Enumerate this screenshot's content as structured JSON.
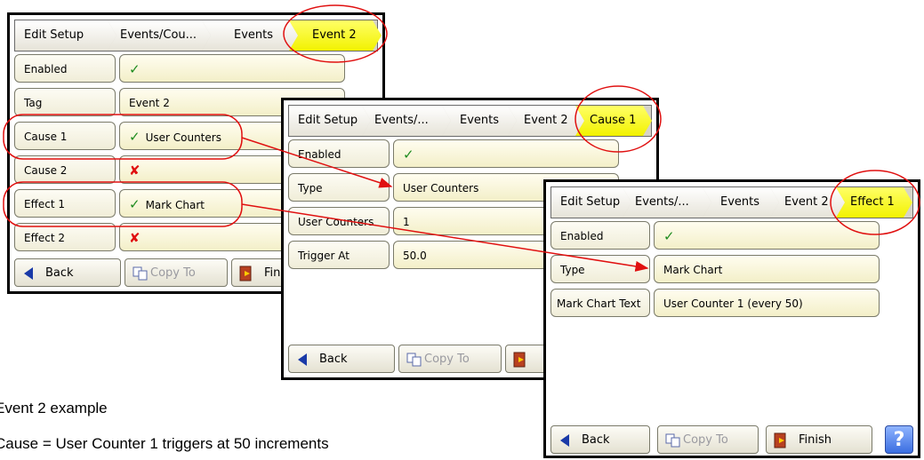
{
  "screens": {
    "event": {
      "crumbs": [
        "Edit Setup",
        "Events/Cou...",
        "Events",
        "Event 2"
      ],
      "rows": [
        {
          "label": "Enabled",
          "value": "",
          "state": "check"
        },
        {
          "label": "Tag",
          "value": "Event 2",
          "state": "text"
        },
        {
          "label": "Cause 1",
          "value": "User Counters",
          "state": "check"
        },
        {
          "label": "Cause 2",
          "value": "",
          "state": "cross"
        },
        {
          "label": "Effect 1",
          "value": "Mark Chart",
          "state": "check"
        },
        {
          "label": "Effect 2",
          "value": "",
          "state": "cross"
        }
      ],
      "buttons": {
        "back": "Back",
        "copy_to": "Copy To",
        "finish": "Fin"
      }
    },
    "cause": {
      "crumbs": [
        "Edit Setup",
        "Events/...",
        "Events",
        "Event 2",
        "Cause 1"
      ],
      "rows": [
        {
          "label": "Enabled",
          "value": "",
          "state": "check"
        },
        {
          "label": "Type",
          "value": "User Counters",
          "state": "text"
        },
        {
          "label": "User Counters",
          "value": "1",
          "state": "text"
        },
        {
          "label": "Trigger At",
          "value": "50.0",
          "state": "text"
        }
      ],
      "buttons": {
        "back": "Back",
        "copy_to": "Copy To"
      }
    },
    "effect": {
      "crumbs": [
        "Edit Setup",
        "Events/...",
        "Events",
        "Event 2",
        "Effect 1"
      ],
      "rows": [
        {
          "label": "Enabled",
          "value": "",
          "state": "check"
        },
        {
          "label": "Type",
          "value": "Mark Chart",
          "state": "text"
        },
        {
          "label": "Mark Chart Text",
          "value": "User Counter 1 (every 50)",
          "state": "text"
        }
      ],
      "buttons": {
        "back": "Back",
        "copy_to": "Copy To",
        "finish": "Finish",
        "help": "?"
      }
    }
  },
  "captions": {
    "line1": "Event 2 example",
    "line2": "Cause = User Counter 1 triggers at 50 increments"
  },
  "colors": {
    "annotation": "#e01010",
    "check": "#1f8c1f",
    "active_crumb": "#ffff33"
  }
}
